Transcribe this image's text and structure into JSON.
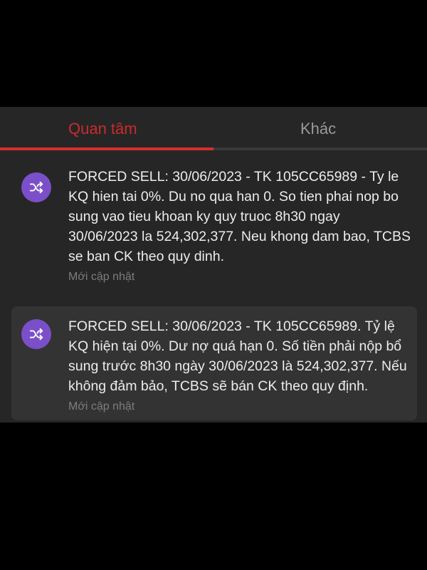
{
  "tabs": [
    {
      "label": "Quan tâm",
      "active": true
    },
    {
      "label": "Khác",
      "active": false
    }
  ],
  "notifications": [
    {
      "message": "FORCED SELL: 30/06/2023 - TK 105CC65989 - Ty le KQ hien tai 0%. Du no qua han 0. So tien phai nop bo sung vao tieu khoan ky quy truoc 8h30 ngay 30/06/2023 la 524,302,377. Neu khong dam bao, TCBS se ban CK theo quy dinh.",
      "time": "Mới cập nhật",
      "icon": "shuffle-icon"
    },
    {
      "message": "FORCED SELL: 30/06/2023 - TK 105CC65989. Tỷ lệ KQ hiện tại 0%. Dư nợ quá hạn 0. Số tiền phải nộp bổ sung trước 8h30 ngày 30/06/2023 là 524,302,377. Nếu không đảm bảo, TCBS sẽ bán CK theo quy định.",
      "time": "Mới cập nhật",
      "icon": "shuffle-icon"
    }
  ],
  "colors": {
    "accent": "#d32f2f",
    "avatar": "#7b4fc9",
    "background": "#262626",
    "card_highlight": "#333333"
  }
}
